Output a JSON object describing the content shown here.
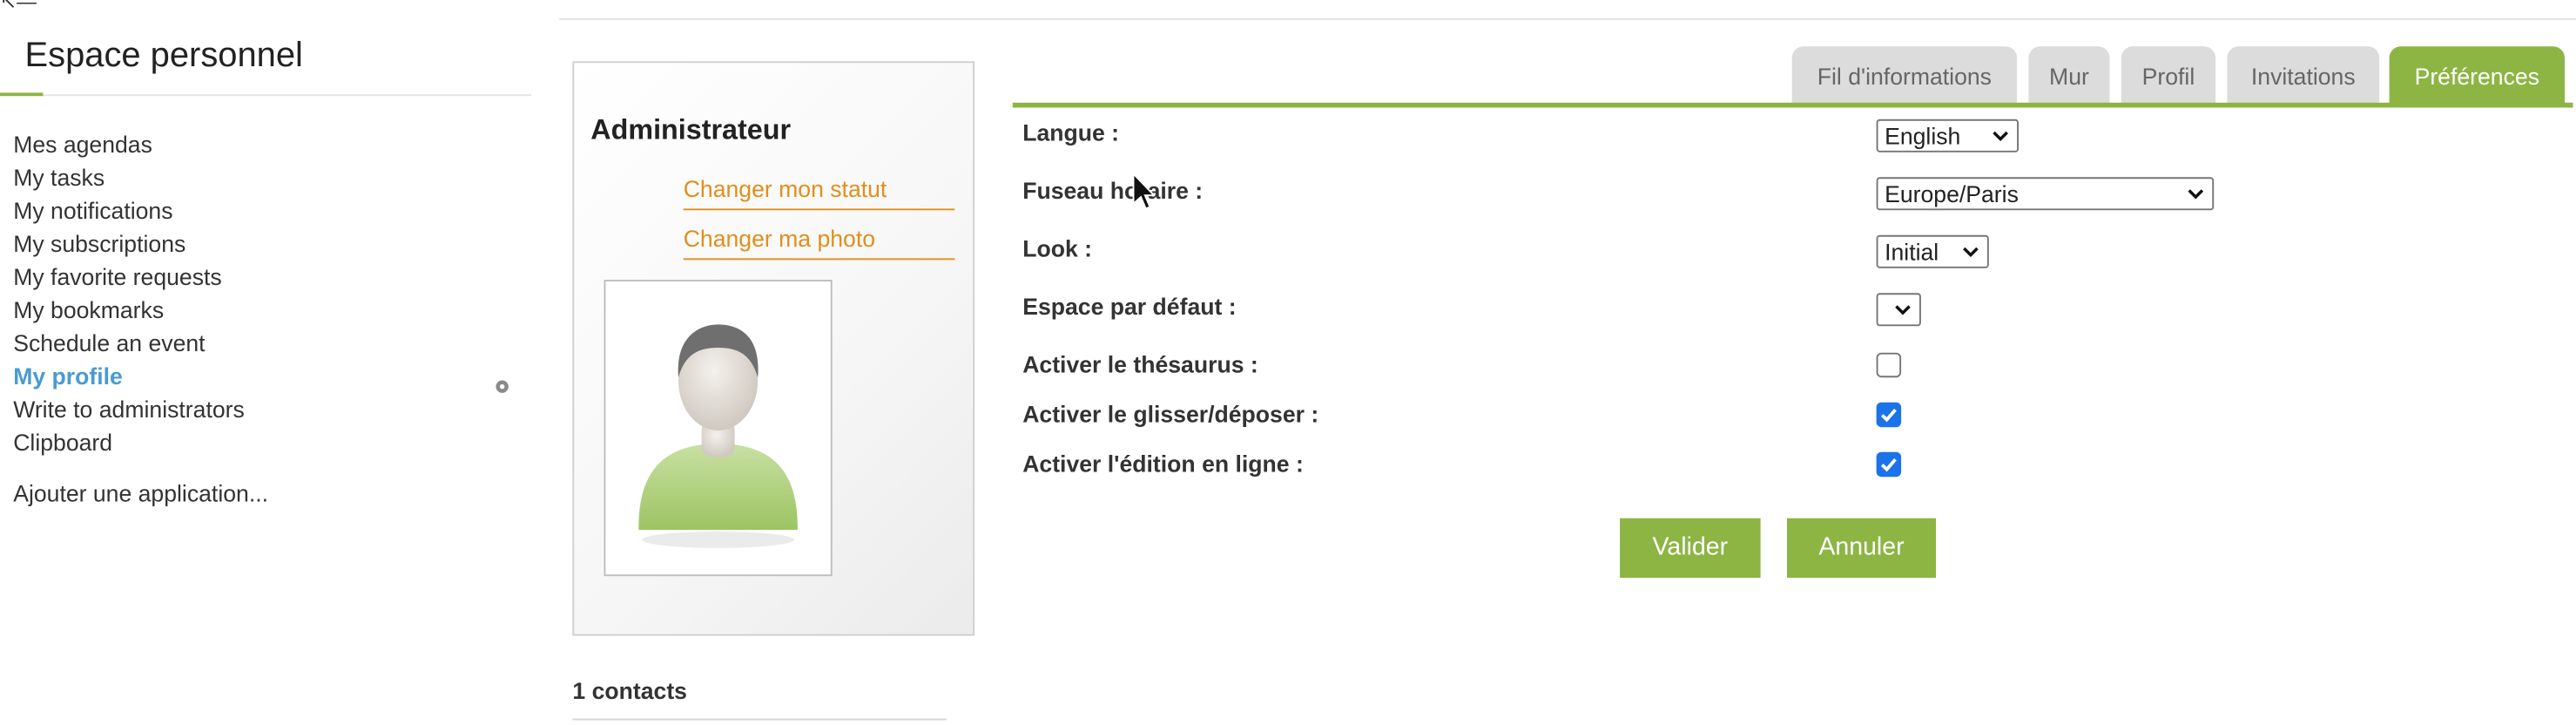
{
  "corner_glyph": "↖—",
  "sidebar": {
    "title": "Espace personnel",
    "items": [
      {
        "label": "Mes agendas"
      },
      {
        "label": "My tasks"
      },
      {
        "label": "My notifications"
      },
      {
        "label": "My subscriptions"
      },
      {
        "label": "My favorite requests"
      },
      {
        "label": "My bookmarks"
      },
      {
        "label": "Schedule an event"
      },
      {
        "label": "My profile",
        "active": true
      },
      {
        "label": "Write to administrators"
      },
      {
        "label": "Clipboard"
      }
    ],
    "add_application": "Ajouter une application...",
    "settings_icon": "gear-icon"
  },
  "profile_card": {
    "name": "Administrateur",
    "change_status": "Changer mon statut",
    "change_photo": "Changer ma photo",
    "avatar_icon": "user-avatar-icon",
    "contacts": "1 contacts"
  },
  "tabs": [
    {
      "label": "Fil d'informations",
      "active": false
    },
    {
      "label": "Mur",
      "active": false
    },
    {
      "label": "Profil",
      "active": false
    },
    {
      "label": "Invitations",
      "active": false
    },
    {
      "label": "Préférences",
      "active": true
    }
  ],
  "form": {
    "language": {
      "label": "Langue :",
      "value": "English"
    },
    "timezone": {
      "label": "Fuseau horaire :",
      "value": "Europe/Paris"
    },
    "look": {
      "label": "Look :",
      "value": "Initial"
    },
    "default_space": {
      "label": "Espace par défaut :",
      "value": ""
    },
    "thesaurus": {
      "label": "Activer le thésaurus :",
      "checked": false
    },
    "drag_drop": {
      "label": "Activer le glisser/déposer :",
      "checked": true
    },
    "online_edit": {
      "label": "Activer l'édition en ligne :",
      "checked": true
    },
    "submit_label": "Valider",
    "cancel_label": "Annuler"
  },
  "colors": {
    "accent": "#8cb544",
    "link_orange": "#e08f1c",
    "active_link": "#4a9bd3",
    "checkbox_blue": "#1a73e8"
  }
}
